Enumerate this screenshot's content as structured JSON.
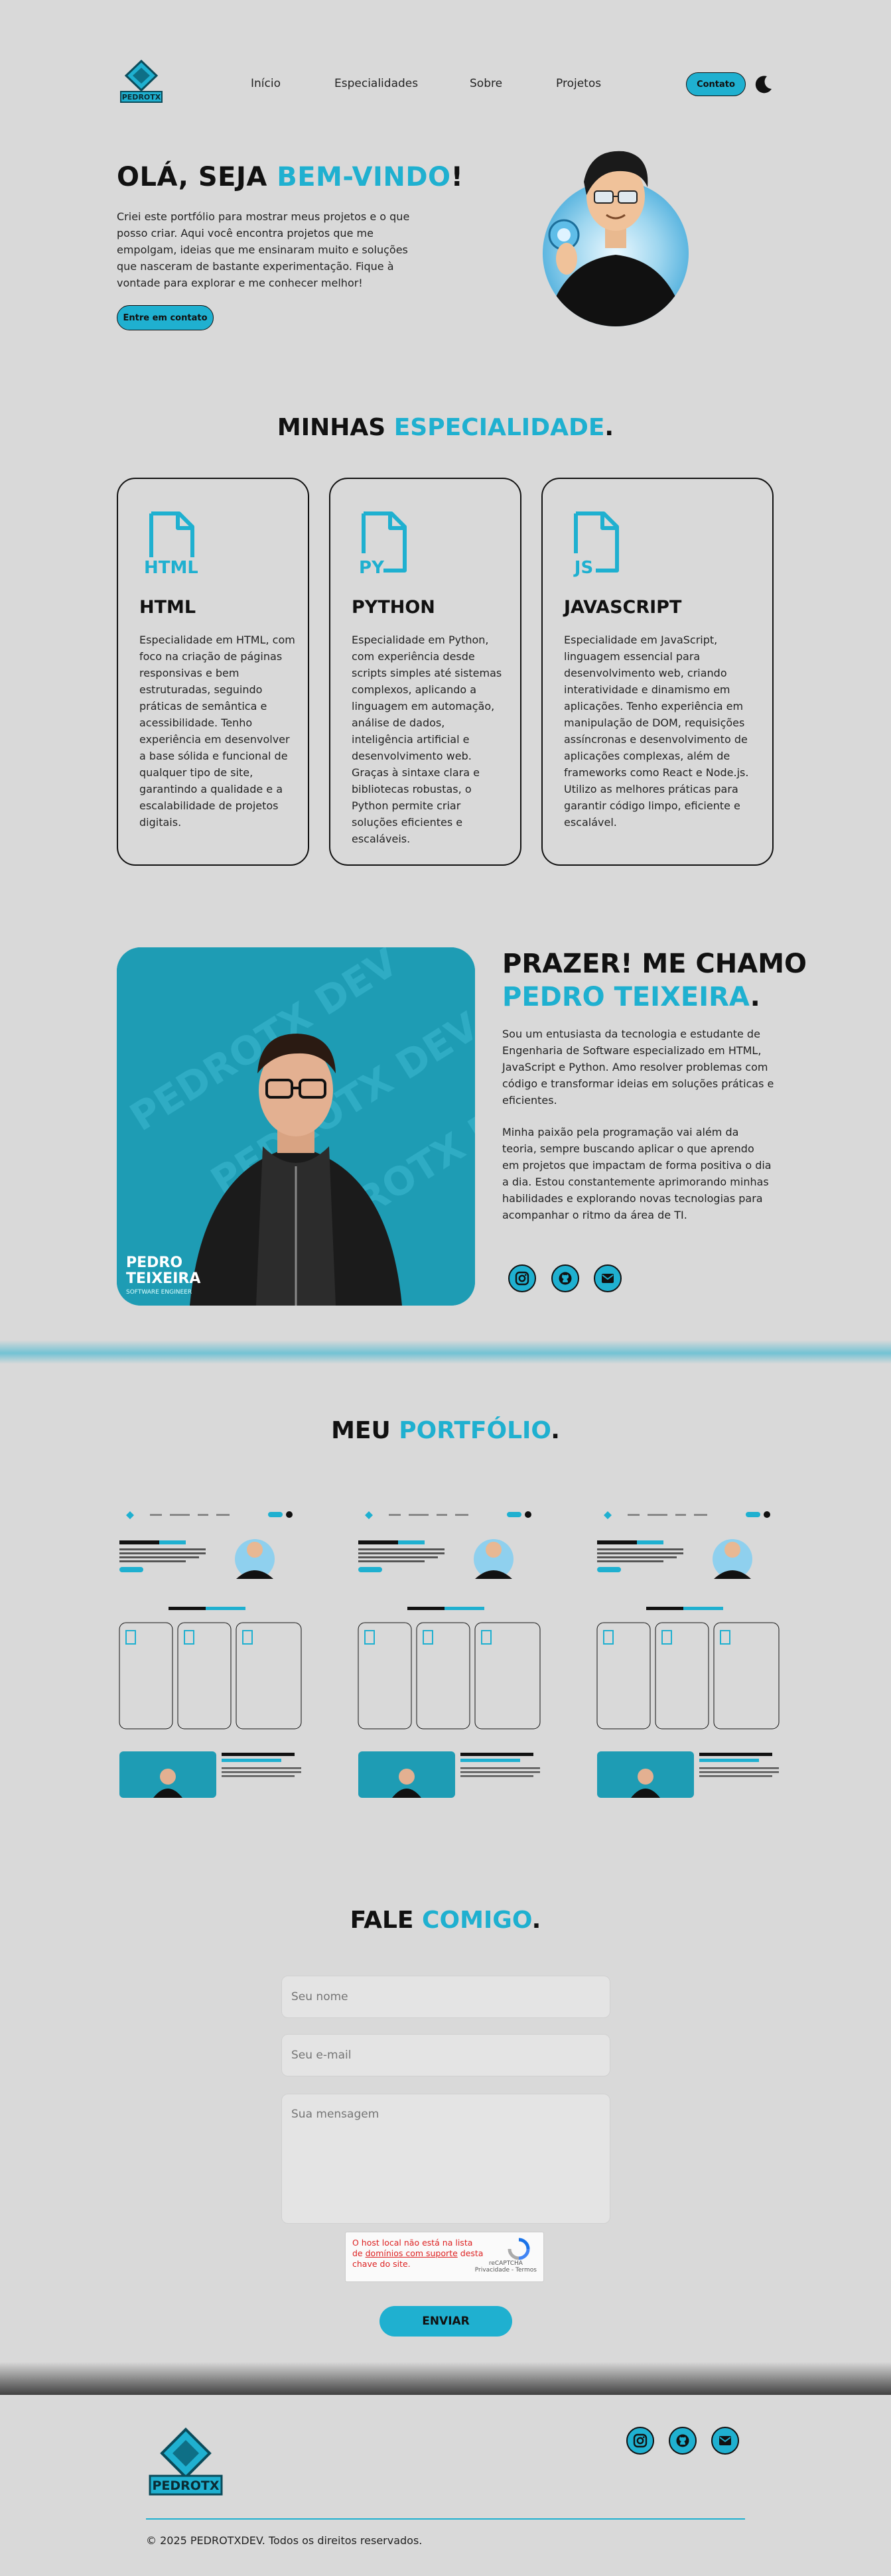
{
  "colors": {
    "accent": "#1fb0d0",
    "background": "#d9d9d9",
    "text": "#111111"
  },
  "nav": {
    "logo_text": "PEDROTX",
    "links": [
      "Início",
      "Especialidades",
      "Sobre",
      "Projetos"
    ],
    "contact_label": "Contato",
    "theme_icon": "moon-icon"
  },
  "hero": {
    "title_prefix": "OLÁ, SEJA ",
    "title_accent": "BEM-VINDO",
    "title_suffix": "!",
    "text": "Criei este portfólio para mostrar meus projetos e o que posso criar. Aqui você encontra projetos que me empolgam, ideias que me ensinaram muito e soluções que nasceram de bastante experimentação. Fique à vontade para explorar e me conhecer melhor!",
    "button_label": "Entre em contato"
  },
  "specialities": {
    "title_prefix": "MINHAS ",
    "title_accent": "ESPECIALIDADE",
    "title_suffix": ".",
    "cards": [
      {
        "icon_label": "HTML",
        "title": "HTML",
        "text": "Especialidade em HTML, com foco na criação de páginas responsivas e bem estruturadas, seguindo práticas de semântica e acessibilidade. Tenho experiência em desenvolver a base sólida e funcional de qualquer tipo de site, garantindo a qualidade e a escalabilidade de projetos digitais."
      },
      {
        "icon_label": "PY",
        "title": "PYTHON",
        "text": "Especialidade em Python, com experiência desde scripts simples até sistemas complexos, aplicando a linguagem em automação, análise de dados, inteligência artificial e desenvolvimento web. Graças à sintaxe clara e bibliotecas robustas, o Python permite criar soluções eficientes e escaláveis."
      },
      {
        "icon_label": "JS",
        "title": "JAVASCRIPT",
        "text": "Especialidade em JavaScript, linguagem essencial para desenvolvimento web, criando interatividade e dinamismo em aplicações. Tenho experiência em manipulação de DOM, requisições assíncronas e desenvolvimento de aplicações complexas, além de frameworks como React e Node.js. Utilizo as melhores práticas para garantir código limpo, eficiente e escalável."
      }
    ]
  },
  "about": {
    "photo_watermark": "PEDROTX DEV",
    "photo_name": "PEDRO\nTEIXEIRA",
    "photo_name_line1": "PEDRO",
    "photo_name_line2": "TEIXEIRA",
    "photo_subtitle": "SOFTWARE ENGINEER",
    "title_line1": "PRAZER! ME CHAMO",
    "title_accent": "PEDRO TEIXEIRA",
    "title_suffix": ".",
    "paragraph1": "Sou um entusiasta da tecnologia e estudante de Engenharia de Software especializado em HTML, JavaScript e Python. Amo resolver problemas com código e transformar ideias em soluções práticas e eficientes.",
    "paragraph2": "Minha paixão pela programação vai além da teoria, sempre buscando aplicar o que aprendo em projetos que impactam de forma positiva o dia a dia. Estou constantemente aprimorando minhas habilidades e explorando novas tecnologias para acompanhar o ritmo da área de TI.",
    "socials": [
      "instagram-icon",
      "github-icon",
      "mail-icon"
    ]
  },
  "portfolio": {
    "title_prefix": "MEU ",
    "title_accent": "PORTFÓLIO",
    "title_suffix": "."
  },
  "contact": {
    "title_prefix": "FALE ",
    "title_accent": "COMIGO",
    "title_suffix": ".",
    "name_placeholder": "Seu nome",
    "email_placeholder": "Seu e-mail",
    "message_placeholder": "Sua mensagem",
    "captcha_error_line1": "O host local não está na lista de ",
    "captcha_error_link": "domínios com suporte",
    "captcha_error_line2": " desta chave do site.",
    "captcha_brand": "reCAPTCHA",
    "captcha_terms": "Privacidade - Termos",
    "send_label": "ENVIAR"
  },
  "footer": {
    "logo_text": "PEDROTX",
    "copyright": "© 2025 PEDROTXDEV. Todos os direitos reservados.",
    "socials": [
      "instagram-icon",
      "github-icon",
      "mail-icon"
    ]
  }
}
